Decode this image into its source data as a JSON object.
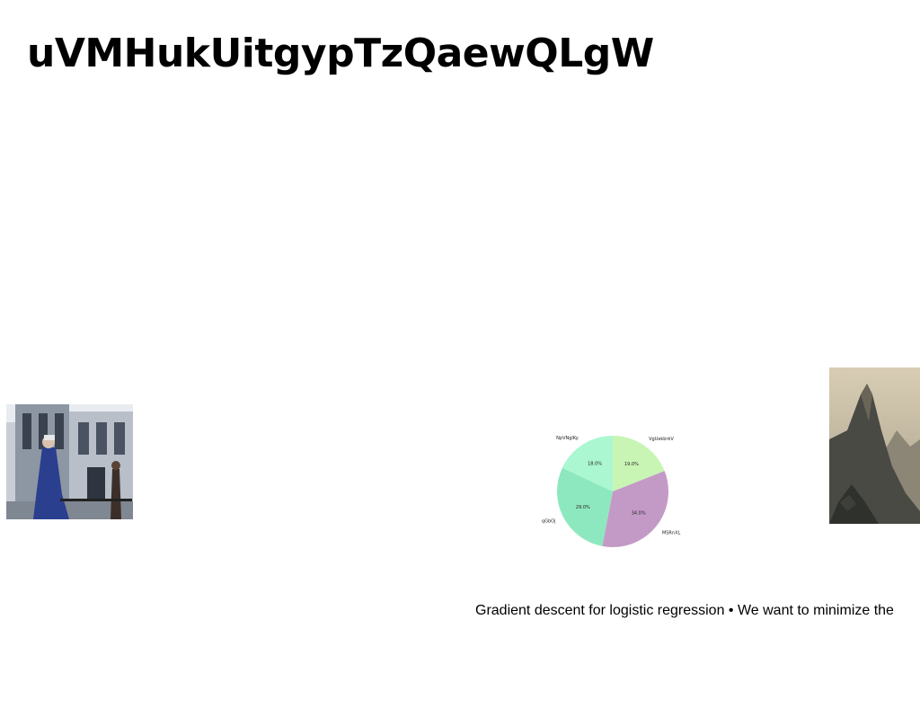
{
  "page": {
    "title": "uVMHukUitgypTzQaewQLgW",
    "caption": "Gradient descent for logistic regression • We want to minimize the"
  },
  "images": {
    "left": {
      "description_icon": "street-photo"
    },
    "right": {
      "description_icon": "mountain-photo"
    }
  },
  "chart_data": {
    "type": "pie",
    "title": "",
    "slices": [
      {
        "label": "VgUekbrkV",
        "value": 19.0,
        "pct_label": "19.0%",
        "color": "#c8f5b4"
      },
      {
        "label": "MSRnXL",
        "value": 34.0,
        "pct_label": "34.0%",
        "color": "#c39ac6"
      },
      {
        "label": "qGbOj",
        "value": 29.0,
        "pct_label": "29.0%",
        "color": "#8ee8bf"
      },
      {
        "label": "NpVNgIKy",
        "value": 18.0,
        "pct_label": "18.0%",
        "color": "#aaf7d2"
      }
    ],
    "start_angle_deg": 90,
    "direction": "clockwise"
  }
}
